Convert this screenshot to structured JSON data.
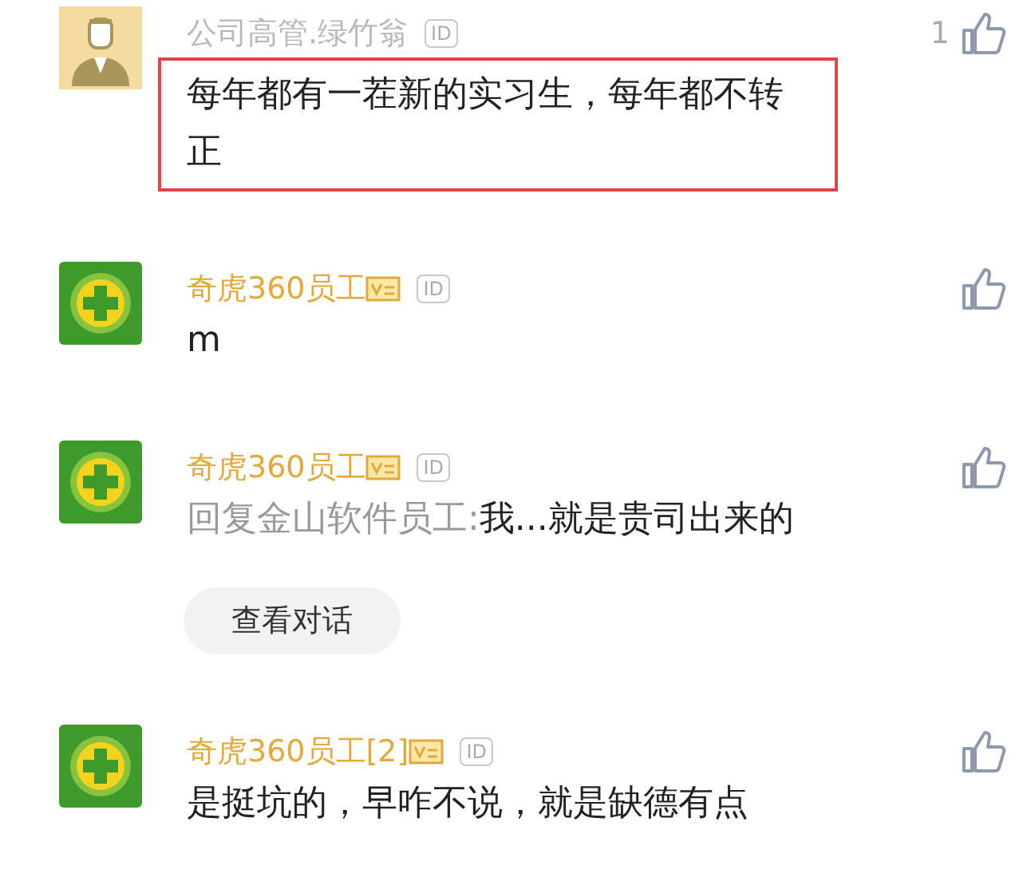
{
  "comments": [
    {
      "author": "公司高管.绿竹翁",
      "verified": false,
      "kind": "person",
      "id_badge": "ID",
      "like_count": "1",
      "highlighted": true,
      "text": "每年都有一茬新的实习生，每年都不转正"
    },
    {
      "author": "奇虎360员工",
      "verified": true,
      "kind": "logo",
      "id_badge": "ID",
      "text": "m"
    },
    {
      "author": "奇虎360员工",
      "verified": true,
      "kind": "logo",
      "id_badge": "ID",
      "reply_to": "回复金山软件员工:",
      "text": "我...就是贵司出来的",
      "action": "查看对话"
    },
    {
      "author": "奇虎360员工[2]",
      "verified": true,
      "kind": "logo",
      "id_badge": "ID",
      "text": "是挺坑的，早咋不说，就是缺德有点"
    }
  ]
}
